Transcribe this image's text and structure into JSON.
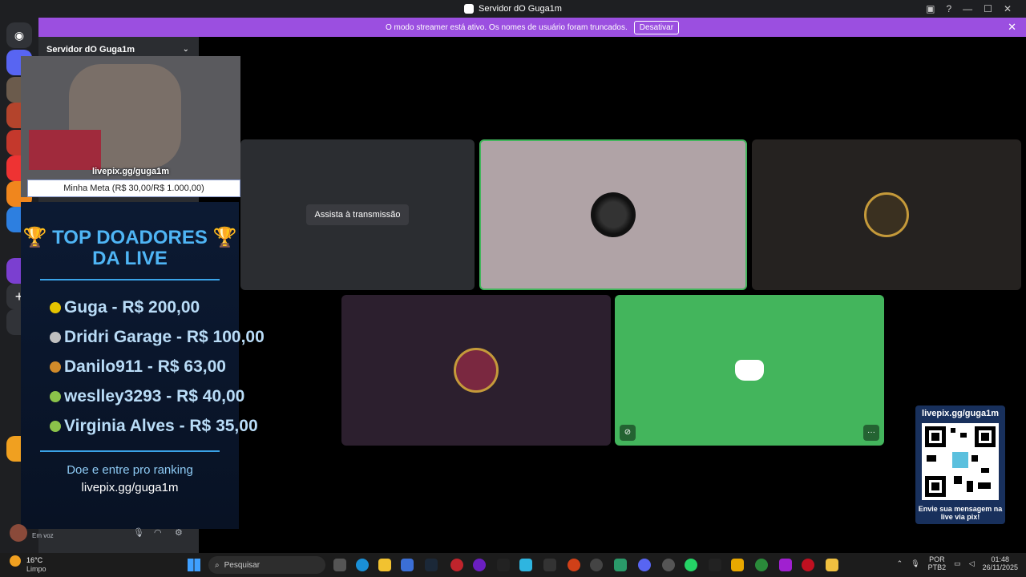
{
  "window": {
    "title": "Servidor dO Guga1m"
  },
  "banner": {
    "text": "O modo streamer está ativo. Os nomes de usuário foram truncados.",
    "button": "Desativar"
  },
  "sidebar": {
    "server_name": "Servidor dO Guga1m",
    "status": "Em voz"
  },
  "stage": {
    "watch_button": "Assista à transmissão"
  },
  "overlay": {
    "webcam_url": "livepix.gg/guga1m",
    "goal_text": "Minha Meta (R$ 30,00/R$ 1.000,00)",
    "donors_title_1": "🏆 TOP DOADORES 🏆",
    "donors_title_2": "DA LIVE",
    "donors": [
      {
        "text": "Guga - R$ 200,00",
        "medal_color": "#e5c400"
      },
      {
        "text": "Dridri Garage - R$ 100,00",
        "medal_color": "#c0c0c0"
      },
      {
        "text": "Danilo911 - R$ 63,00",
        "medal_color": "#d08a2a"
      },
      {
        "text": "weslley3293 - R$ 40,00",
        "medal_color": "#8bc34a"
      },
      {
        "text": "Virginia Alves - R$ 35,00",
        "medal_color": "#8bc34a"
      }
    ],
    "footer_1": "Doe e entre pro ranking",
    "footer_2": "livepix.gg/guga1m",
    "qr_title": "livepix.gg/guga1m",
    "qr_caption": "Envie sua mensagem na live via pix!"
  },
  "taskbar": {
    "weather_temp": "16°C",
    "weather_desc": "Limpo",
    "search": "Pesquisar",
    "lang_1": "POR",
    "lang_2": "PTB2",
    "time": "01:48",
    "date": "26/11/2025"
  },
  "colors": {
    "accent": "#9b4fe0",
    "discord_green": "#43b55c",
    "discord_blurple": "#5865f2"
  }
}
